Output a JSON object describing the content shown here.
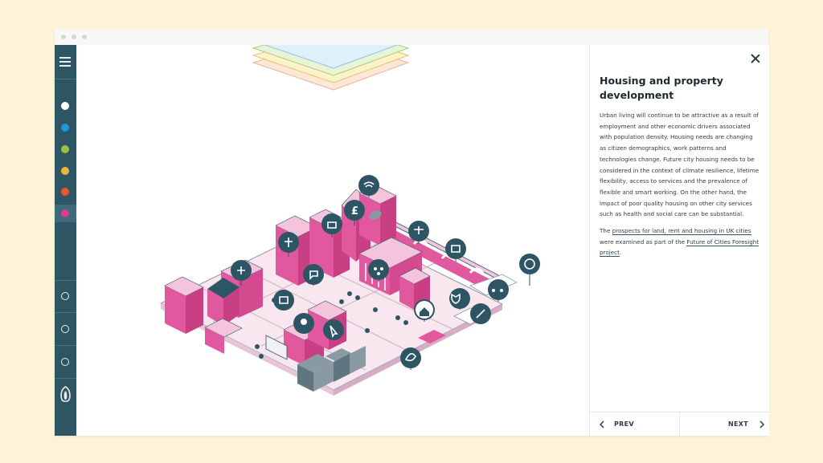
{
  "sidebar": {
    "menu_icon": "hamburger-icon",
    "color_filters": [
      {
        "name": "white",
        "color": "#ffffff"
      },
      {
        "name": "blue",
        "color": "#1f98d5"
      },
      {
        "name": "green",
        "color": "#9ac33c"
      },
      {
        "name": "yellow",
        "color": "#e8b73a"
      },
      {
        "name": "orange",
        "color": "#e75a26"
      },
      {
        "name": "magenta",
        "color": "#d53f8c"
      }
    ],
    "logo_icon": "leaf-logo-icon"
  },
  "panel": {
    "title": "Housing and property development",
    "paragraph_1": "Urban living will continue to be attractive as a result of employment and other economic drivers associated with population density. Housing needs are changing as citizen demographics, work patterns and technologies change. Future city housing needs to be considered in the context of climate resilience, lifetime flexibility, access to services and the prevalence of flexible and smart working. On the other hand, the impact of poor quality housing on other city services such as health and social care can be substantial.",
    "p2_prefix": "The ",
    "p2_link1": "prospects for land, rent and housing in UK cities",
    "p2_middle": " were examined as part of the ",
    "p2_link2": "Future of Cities Foresight project",
    "p2_suffix": ".",
    "prev_label": "PREV",
    "next_label": "NEXT"
  },
  "illustration": {
    "icons": [
      "wifi-icon",
      "pound-icon",
      "briefcase-icon",
      "justice-scales-icon",
      "news-icon",
      "cross-icon",
      "medical-plus-icon",
      "chat-icon",
      "people-icon",
      "settings-icon",
      "book-icon",
      "shield-icon",
      "delivery-truck-icon",
      "home-icon",
      "pencil-icon",
      "head-icon",
      "cursor-icon",
      "leaf-icon"
    ],
    "colors": {
      "pink": "#e2589f",
      "lightpink": "#f4c4dc",
      "dark": "#2e5564",
      "grey": "#8a9aa3"
    }
  }
}
